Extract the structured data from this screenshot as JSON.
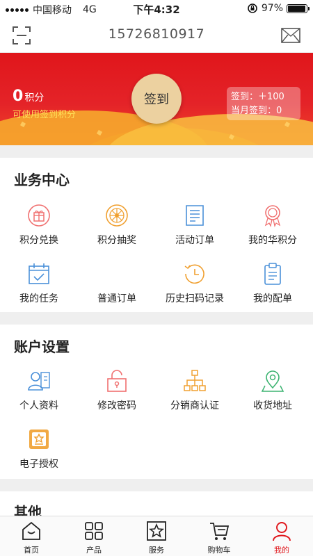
{
  "status_bar": {
    "carrier": "中国移动",
    "network": "4G",
    "time": "下午4:32",
    "battery_text": "97%",
    "battery_level": 0.97
  },
  "header": {
    "title": "15726810917",
    "left_icon": "scan-icon",
    "right_icon": "mail-icon"
  },
  "banner": {
    "points_value": "0",
    "points_unit": "积分",
    "points_sub": "可使用签到积分",
    "sign_button": "签到",
    "sign_reward": "签到：＋100",
    "month_signed": "当月签到：0"
  },
  "business": {
    "title": "业务中心",
    "items": [
      {
        "label": "积分兑换",
        "icon": "gift-icon"
      },
      {
        "label": "积分抽奖",
        "icon": "lottery-wheel-icon"
      },
      {
        "label": "活动订单",
        "icon": "document-icon"
      },
      {
        "label": "我的华积分",
        "icon": "medal-icon"
      },
      {
        "label": "我的任务",
        "icon": "calendar-check-icon"
      },
      {
        "label": "普通订单",
        "icon": "order-icon"
      },
      {
        "label": "历史扫码记录",
        "icon": "history-clock-icon"
      },
      {
        "label": "我的配单",
        "icon": "clipboard-icon"
      }
    ]
  },
  "account": {
    "title": "账户设置",
    "items": [
      {
        "label": "个人资料",
        "icon": "profile-icon"
      },
      {
        "label": "修改密码",
        "icon": "lock-icon"
      },
      {
        "label": "分销商认证",
        "icon": "org-chart-icon"
      },
      {
        "label": "收货地址",
        "icon": "location-pin-icon"
      },
      {
        "label": "电子授权",
        "icon": "certificate-icon"
      }
    ]
  },
  "other": {
    "title": "其他"
  },
  "bottom_nav": {
    "items": [
      {
        "label": "首页",
        "icon": "home-icon"
      },
      {
        "label": "产品",
        "icon": "grid-icon"
      },
      {
        "label": "服务",
        "icon": "service-star-icon"
      },
      {
        "label": "购物车",
        "icon": "cart-icon"
      },
      {
        "label": "我的",
        "icon": "user-icon"
      }
    ],
    "active": "我的"
  },
  "colors": {
    "brand_red": "#e0161b",
    "accent_orange": "#f0a030",
    "accent_blue": "#4a90d9",
    "accent_green": "#3cb371",
    "accent_pink": "#f07070"
  }
}
